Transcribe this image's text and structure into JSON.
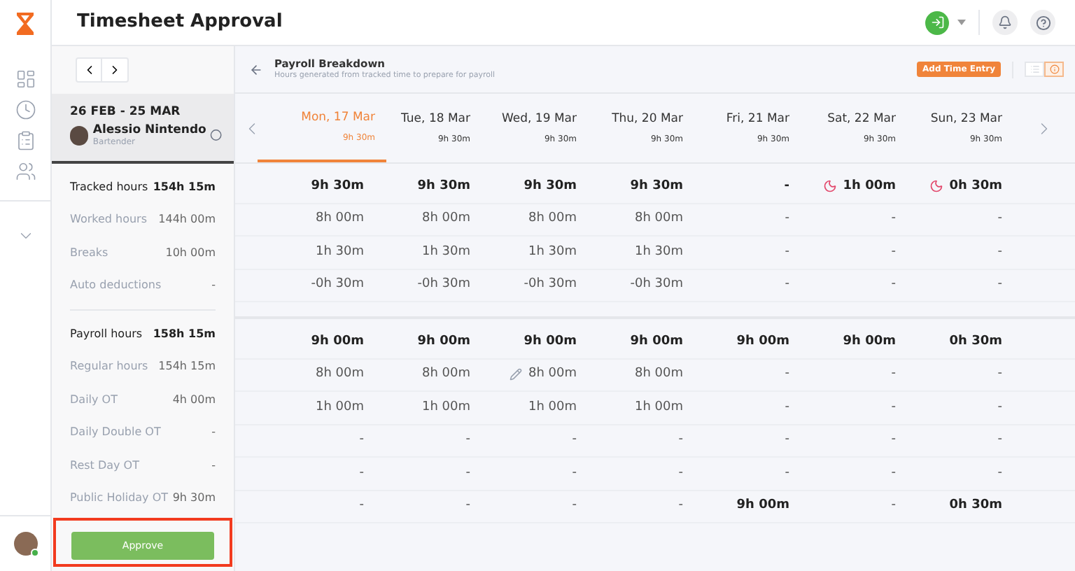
{
  "header": {
    "title": "Timesheet Approval"
  },
  "period": {
    "range": "26 FEB - 25 MAR",
    "name": "Alessio Nintendo",
    "role": "Bartender",
    "selected": true
  },
  "summary": [
    {
      "label": "Tracked hours",
      "value": "154h 15m",
      "kind": "total"
    },
    {
      "label": "Worked hours",
      "value": "144h 00m",
      "kind": "detail"
    },
    {
      "label": "Breaks",
      "value": "10h 00m",
      "kind": "detail"
    },
    {
      "label": "Auto deductions",
      "value": "-",
      "kind": "detail"
    },
    {
      "label": "Payroll hours",
      "value": "158h 15m",
      "kind": "total"
    },
    {
      "label": "Regular hours",
      "value": "154h 15m",
      "kind": "detail"
    },
    {
      "label": "Daily OT",
      "value": "4h 00m",
      "kind": "detail"
    },
    {
      "label": "Daily Double OT",
      "value": "-",
      "kind": "detail"
    },
    {
      "label": "Rest Day OT",
      "value": "-",
      "kind": "detail"
    },
    {
      "label": "Public Holiday OT",
      "value": "9h 30m",
      "kind": "detail"
    }
  ],
  "approve_button": "Approve",
  "breakdown": {
    "title": "Payroll Breakdown",
    "subtitle": "Hours generated from tracked time to prepare for payroll",
    "add_button": "Add Time Entry",
    "views": [
      {
        "kind": "list",
        "selected": false
      },
      {
        "kind": "info",
        "selected": true
      }
    ]
  },
  "days": [
    {
      "label": "Mon, 17 Mar",
      "hours": "9h 30m",
      "selected": true
    },
    {
      "label": "Tue, 18 Mar",
      "hours": "9h 30m",
      "selected": false
    },
    {
      "label": "Wed, 19 Mar",
      "hours": "9h 30m",
      "selected": false
    },
    {
      "label": "Thu, 20 Mar",
      "hours": "9h 30m",
      "selected": false
    },
    {
      "label": "Fri, 21 Mar",
      "hours": "9h 30m",
      "selected": false
    },
    {
      "label": "Sat, 22 Mar",
      "hours": "9h 30m",
      "selected": false
    },
    {
      "label": "Sun, 23 Mar",
      "hours": "9h 30m",
      "selected": false
    }
  ],
  "groups": [
    [
      {
        "kind": "total",
        "cells": [
          "9h 30m",
          "9h 30m",
          "9h 30m",
          "9h 30m",
          "-",
          {
            "text": "1h 00m",
            "kind": "moon"
          },
          {
            "text": "0h 30m",
            "kind": "moon"
          }
        ]
      },
      {
        "kind": "detail",
        "cells": [
          "8h 00m",
          "8h 00m",
          "8h 00m",
          "8h 00m",
          "-",
          "-",
          "-"
        ]
      },
      {
        "kind": "detail",
        "cells": [
          "1h 30m",
          "1h 30m",
          "1h 30m",
          "1h 30m",
          "-",
          "-",
          "-"
        ]
      },
      {
        "kind": "detail",
        "cells": [
          "-0h 30m",
          "-0h 30m",
          "-0h 30m",
          "-0h 30m",
          "-",
          "-",
          "-"
        ]
      }
    ],
    [
      {
        "kind": "total",
        "cells": [
          "9h 00m",
          "9h 00m",
          "9h 00m",
          "9h 00m",
          "9h 00m",
          "9h 00m",
          "0h 30m"
        ]
      },
      {
        "kind": "detail",
        "cells": [
          "8h 00m",
          "8h 00m",
          {
            "text": "8h 00m",
            "kind": "edited"
          },
          "8h 00m",
          "-",
          "-",
          "-"
        ]
      },
      {
        "kind": "detail",
        "cells": [
          "1h 00m",
          "1h 00m",
          "1h 00m",
          "1h 00m",
          "-",
          "-",
          "-"
        ]
      },
      {
        "kind": "detail",
        "cells": [
          "-",
          "-",
          "-",
          "-",
          "-",
          "-",
          "-"
        ]
      },
      {
        "kind": "detail",
        "cells": [
          "-",
          "-",
          "-",
          "-",
          "-",
          "-",
          "-"
        ]
      },
      {
        "kind": "detail",
        "cells": [
          "-",
          "-",
          "-",
          "-",
          {
            "text": "9h 00m",
            "kind": "bold"
          },
          "-",
          {
            "text": "0h 30m",
            "kind": "bold"
          }
        ]
      }
    ]
  ]
}
